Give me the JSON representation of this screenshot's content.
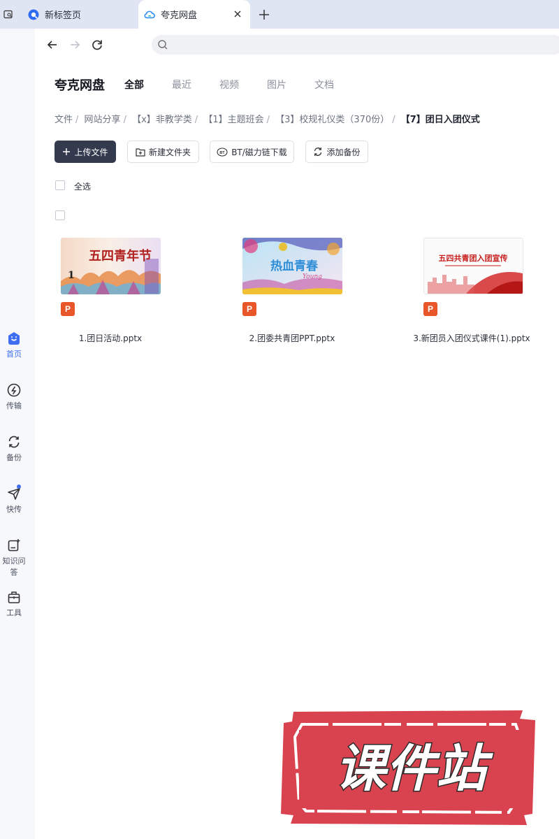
{
  "browser": {
    "tabs": [
      {
        "title": "新标签页",
        "active": false
      },
      {
        "title": "夸克网盘",
        "active": true
      }
    ],
    "address": {
      "placeholder": ""
    }
  },
  "rail": {
    "items": [
      {
        "label": "首页",
        "icon": "home-icon",
        "active": true
      },
      {
        "label": "传输",
        "icon": "transfer-icon"
      },
      {
        "label": "备份",
        "icon": "backup-icon"
      },
      {
        "label": "快传",
        "icon": "quick-send-icon",
        "badge": true
      },
      {
        "label": "知识问答",
        "icon": "qa-icon"
      },
      {
        "label": "工具",
        "icon": "toolbox-icon"
      }
    ]
  },
  "header": {
    "brand": "夸克网盘",
    "nav": [
      "全部",
      "最近",
      "视频",
      "图片",
      "文档"
    ],
    "active_nav": "全部"
  },
  "breadcrumb": {
    "items": [
      "文件",
      "网站分享",
      "【x】非教学类",
      "【1】主题班会",
      "【3】校规礼仪类（370份）"
    ],
    "current": "【7】团日入团仪式"
  },
  "actions": {
    "upload": "上传文件",
    "new_folder": "新建文件夹",
    "bt_download": "BT/磁力链下载",
    "add_backup": "添加备份"
  },
  "list": {
    "select_all_label": "全选"
  },
  "files": [
    {
      "name": "1.团日活动.pptx",
      "badge": "P",
      "thumb_text": "五四青年节"
    },
    {
      "name": "2.团委共青团PPT.pptx",
      "badge": "P",
      "thumb_text": "热血青春"
    },
    {
      "name": "3.新团员入团仪式课件(1).pptx",
      "badge": "P",
      "thumb_text": "五四共青团入团宣传"
    }
  ],
  "watermark": {
    "text": "课件站"
  },
  "colors": {
    "accent": "#3f6ef0",
    "primary_button": "#343a4d",
    "ppt_badge": "#e8562a",
    "stamp_red": "#d9424f"
  }
}
